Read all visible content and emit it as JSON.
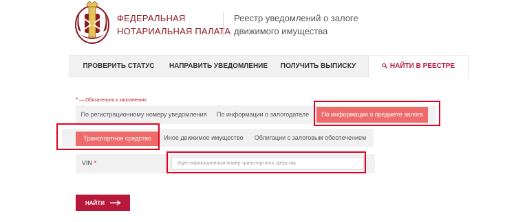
{
  "header": {
    "org_line1": "ФЕДЕРАЛЬНАЯ",
    "org_line2": "НОТАРИАЛЬНАЯ ПАЛАТА",
    "registry_line1": "Реестр уведомлений о залоге",
    "registry_line2": "движимого имущества",
    "logo_icon": "notary-chamber-emblem",
    "brand_color": "#8b1a1f"
  },
  "nav": {
    "items": [
      {
        "label": "ПРОВЕРИТЬ СТАТУС"
      },
      {
        "label": "НАПРАВИТЬ УВЕДОМЛЕНИЕ"
      },
      {
        "label": "ПОЛУЧИТЬ ВЫПИСКУ"
      },
      {
        "label": "НАЙТИ В РЕЕСТРЕ",
        "icon": "search-icon",
        "active": true
      }
    ],
    "active_color": "#b8193b"
  },
  "form": {
    "required_star": "*",
    "required_note": "— Обязательно к заполнению",
    "search_tabs": [
      {
        "label": "По регистрационному номеру уведомления"
      },
      {
        "label": "По информации о залогодателе"
      },
      {
        "label": "По информации о предмете залога",
        "active": true
      }
    ],
    "property_tabs": [
      {
        "label": "Транспортное средство",
        "active": true
      },
      {
        "label": "Иное движимое имущество"
      },
      {
        "label": "Облигации с залоговым обеспечением"
      }
    ],
    "vin": {
      "label": "VIN",
      "required_star": "*",
      "placeholder": "Идентификационный номер транспортного средства",
      "value": ""
    },
    "submit_label": "НАЙТИ",
    "submit_icon": "arrow-right-icon",
    "active_tab_color": "#ee6b6b",
    "highlight_color": "#e3001b"
  }
}
